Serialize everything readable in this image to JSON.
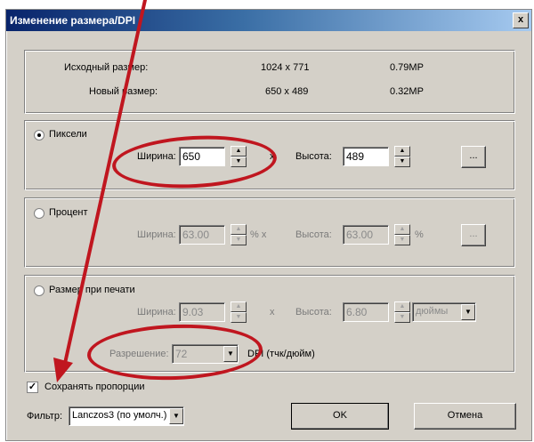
{
  "window": {
    "title": "Изменение размера/DPI",
    "close": "x"
  },
  "info": {
    "original_label": "Исходный размер:",
    "original_value": "1024 x 771",
    "original_mp": "0.79MP",
    "new_label": "Новый размер:",
    "new_value": "650 x 489",
    "new_mp": "0.32MP"
  },
  "pixels": {
    "label": "Пиксели",
    "width_label": "Ширина:",
    "width_value": "650",
    "x": "x",
    "height_label": "Высота:",
    "height_value": "489",
    "more": "..."
  },
  "percent": {
    "label": "Процент",
    "width_label": "Ширина:",
    "width_value": "63.00",
    "pct1": "% x",
    "height_label": "Высота:",
    "height_value": "63.00",
    "pct2": "%",
    "more": "..."
  },
  "print": {
    "label": "Размер при печати",
    "width_label": "Ширина:",
    "width_value": "9.03",
    "x": "x",
    "height_label": "Высота:",
    "height_value": "6.80",
    "unit": "дюймы",
    "resolution_label": "Разрешение:",
    "resolution_value": "72",
    "dpi_label": "DPI (тчк/дюйм)"
  },
  "keep_proportions": {
    "label": "Сохранять пропорции",
    "checked": true
  },
  "filter": {
    "label": "Фильтр:",
    "value": "Lanczos3 (по умолч.)"
  },
  "buttons": {
    "ok": "OK",
    "cancel": "Отмена"
  },
  "colors": {
    "annotation": "#c0161f",
    "dialog_bg": "#d4d0c8"
  }
}
